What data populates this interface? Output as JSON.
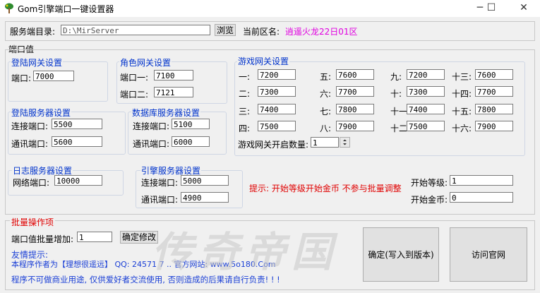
{
  "window": {
    "title": "Gom引擎端口一键设置器",
    "minimize_glyph": "─",
    "maximize_glyph": "☐",
    "close_glyph": "✕"
  },
  "server": {
    "dir_label": "服务端目录:",
    "dir_value": "D:\\MirServer",
    "browse_label": "浏览",
    "zone_label": "当前区名:",
    "zone_value": "逍遥火龙22日01区"
  },
  "ports_title": "端口值",
  "login_gate": {
    "title": "登陆网关设置",
    "port_label": "端口:",
    "port_value": "7000"
  },
  "role_gate": {
    "title": "角色网关设置",
    "port1_label": "端口一:",
    "port1_value": "7100",
    "port2_label": "端口二:",
    "port2_value": "7121"
  },
  "game_gate": {
    "title": "游戏网关设置",
    "ports": [
      {
        "label": "一:",
        "value": "7200"
      },
      {
        "label": "二:",
        "value": "7300"
      },
      {
        "label": "三:",
        "value": "7400"
      },
      {
        "label": "四:",
        "value": "7500"
      },
      {
        "label": "五:",
        "value": "7600"
      },
      {
        "label": "六:",
        "value": "7700"
      },
      {
        "label": "七:",
        "value": "7800"
      },
      {
        "label": "八:",
        "value": "7900"
      },
      {
        "label": "九:",
        "value": "7200"
      },
      {
        "label": "十:",
        "value": "7300"
      },
      {
        "label": "十一:",
        "value": "7400"
      },
      {
        "label": "十二:",
        "value": "7500"
      },
      {
        "label": "十三:",
        "value": "7600"
      },
      {
        "label": "十四:",
        "value": "7700"
      },
      {
        "label": "十五:",
        "value": "7800"
      },
      {
        "label": "十六:",
        "value": "7900"
      }
    ],
    "count_label": "游戏网关开启数量:",
    "count_value": "1"
  },
  "login_server": {
    "title": "登陆服务器设置",
    "conn_label": "连接端口:",
    "conn_value": "5500",
    "comm_label": "通讯端口:",
    "comm_value": "5600"
  },
  "db_server": {
    "title": "数据库服务器设置",
    "conn_label": "连接端口:",
    "conn_value": "5100",
    "comm_label": "通讯端口:",
    "comm_value": "6000"
  },
  "log_server": {
    "title": "日志服务器设置",
    "net_label": "网络端口:",
    "net_value": "10000"
  },
  "engine_server": {
    "title": "引擎服务器设置",
    "conn_label": "连接端口:",
    "conn_value": "5000",
    "comm_label": "通讯端口:",
    "comm_value": "4900"
  },
  "hint": "提示: 开始等级开始金币 不参与批量调整",
  "start_level": {
    "label": "开始等级:",
    "value": "1"
  },
  "start_gold": {
    "label": "开始金币:",
    "value": "0"
  },
  "batch": {
    "title": "批量操作项",
    "increase_label": "端口值批量增加:",
    "increase_value": "1",
    "confirm_label": "确定修改"
  },
  "notes": {
    "title": "友情提示:",
    "line1": "本程序作者为【理想很遥远】 QQ: 24571 7 .. 官方网站: www.5o180.Com",
    "line2": "程序不可做商业用途, 仅供爱好者交流使用, 否则造成的后果请自行负责! ! !"
  },
  "buttons": {
    "apply_label": "确定(写入到版本)",
    "visit_label": "访问官网"
  },
  "watermark": "传奇帝国"
}
